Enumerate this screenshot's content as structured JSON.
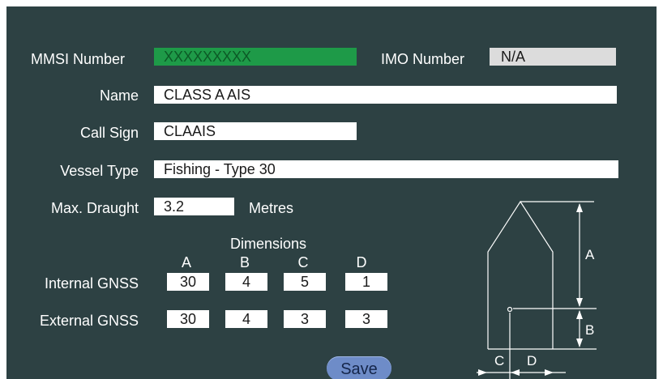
{
  "form": {
    "mmsi": {
      "label": "MMSI Number",
      "value": "XXXXXXXXX"
    },
    "imo": {
      "label": "IMO Number",
      "value": "N/A"
    },
    "name": {
      "label": "Name",
      "value": "CLASS A AIS"
    },
    "call_sign": {
      "label": "Call Sign",
      "value": "CLAAIS"
    },
    "vessel_type": {
      "label": "Vessel Type",
      "value": "Fishing - Type 30"
    },
    "draught": {
      "label": "Max. Draught",
      "value": "3.2",
      "unit": "Metres"
    }
  },
  "dimensions": {
    "title": "Dimensions",
    "columns": [
      "A",
      "B",
      "C",
      "D"
    ],
    "internal": {
      "label": "Internal GNSS",
      "values": [
        "30",
        "4",
        "5",
        "1"
      ]
    },
    "external": {
      "label": "External GNSS",
      "values": [
        "30",
        "4",
        "3",
        "3"
      ]
    }
  },
  "diagram": {
    "labels": [
      "A",
      "B",
      "C",
      "D"
    ]
  },
  "actions": {
    "save_label": "Save"
  },
  "colors": {
    "panel": "#2d4143",
    "mmsi_field": "#1e9a48",
    "imo_field": "#dcdcdc",
    "save_button": "#6e8cc8"
  }
}
